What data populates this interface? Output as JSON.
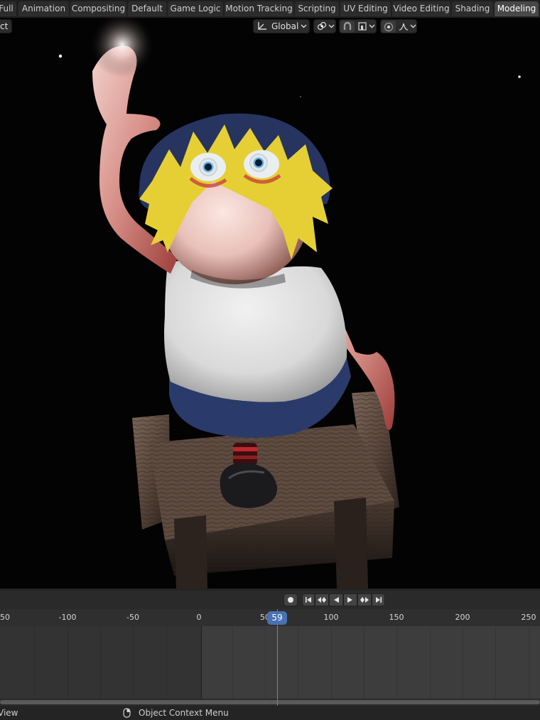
{
  "workspace_tabs": [
    {
      "label": "Full",
      "active": false
    },
    {
      "label": "Animation",
      "active": false
    },
    {
      "label": "Compositing",
      "active": false
    },
    {
      "label": "Default",
      "active": false
    },
    {
      "label": "Game Logic",
      "active": false
    },
    {
      "label": "Motion Tracking",
      "active": false
    },
    {
      "label": "Scripting",
      "active": false
    },
    {
      "label": "UV Editing",
      "active": false
    },
    {
      "label": "Video Editing",
      "active": false
    },
    {
      "label": "Shading",
      "active": false
    },
    {
      "label": "Modeling",
      "active": true
    }
  ],
  "viewport_header": {
    "mode_label": "ct",
    "orientation": "Global"
  },
  "timeline": {
    "current_frame": "59",
    "ruler_labels": [
      "50",
      "-100",
      "-50",
      "0",
      "50",
      "100",
      "150",
      "200",
      "250"
    ]
  },
  "status_bar": {
    "left": "View",
    "center": "Object Context Menu"
  },
  "colors": {
    "accent": "#4772b3",
    "active_tab": "#484848",
    "playhead": "#4f8cd1"
  }
}
